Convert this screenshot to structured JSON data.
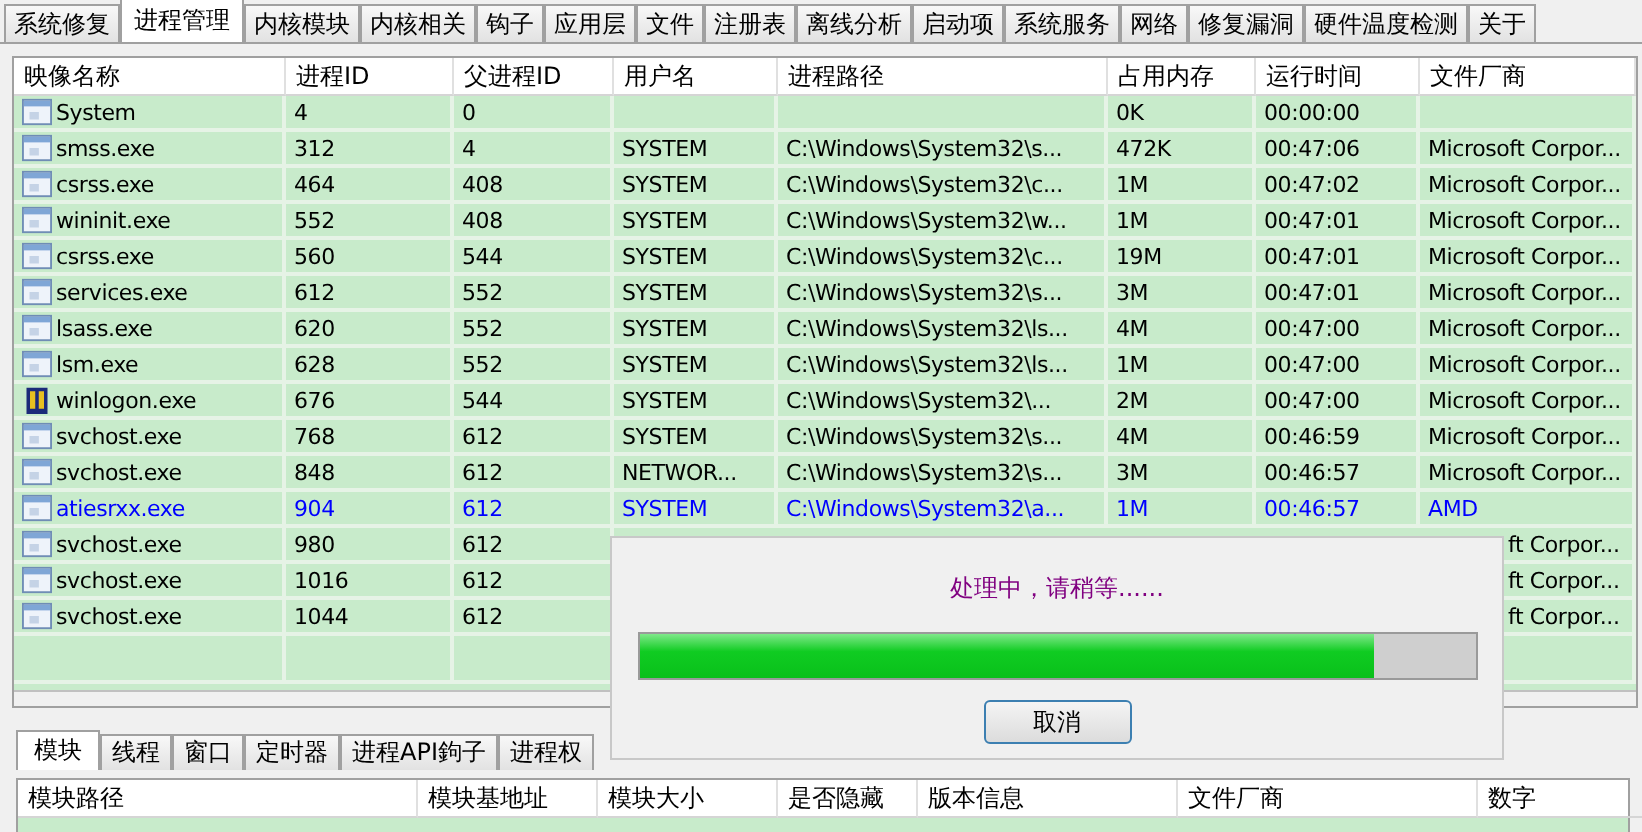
{
  "tabs": [
    {
      "label": "系统修复",
      "selected": false
    },
    {
      "label": "进程管理",
      "selected": true
    },
    {
      "label": "内核模块",
      "selected": false
    },
    {
      "label": "内核相关",
      "selected": false
    },
    {
      "label": "钩子",
      "selected": false
    },
    {
      "label": "应用层",
      "selected": false
    },
    {
      "label": "文件",
      "selected": false
    },
    {
      "label": "注册表",
      "selected": false
    },
    {
      "label": "离线分析",
      "selected": false
    },
    {
      "label": "启动项",
      "selected": false
    },
    {
      "label": "系统服务",
      "selected": false
    },
    {
      "label": "网络",
      "selected": false
    },
    {
      "label": "修复漏洞",
      "selected": false
    },
    {
      "label": "硬件温度检测",
      "selected": false
    },
    {
      "label": "关于",
      "selected": false
    }
  ],
  "process_table": {
    "columns": [
      "映像名称",
      "进程ID",
      "父进程ID",
      "用户名",
      "进程路径",
      "占用内存",
      "运行时间",
      "文件厂商"
    ],
    "rows": [
      {
        "kind": "app",
        "highlighted": false,
        "covered": false,
        "cells": [
          "System",
          "4",
          "0",
          "",
          "",
          "0K",
          "00:00:00",
          ""
        ]
      },
      {
        "kind": "app",
        "highlighted": false,
        "covered": false,
        "cells": [
          "smss.exe",
          "312",
          "4",
          "SYSTEM",
          "C:\\Windows\\System32\\s...",
          "472K",
          "00:47:06",
          "Microsoft Corpor..."
        ]
      },
      {
        "kind": "app",
        "highlighted": false,
        "covered": false,
        "cells": [
          "csrss.exe",
          "464",
          "408",
          "SYSTEM",
          "C:\\Windows\\System32\\c...",
          "1M",
          "00:47:02",
          "Microsoft Corpor..."
        ]
      },
      {
        "kind": "app",
        "highlighted": false,
        "covered": false,
        "cells": [
          "wininit.exe",
          "552",
          "408",
          "SYSTEM",
          "C:\\Windows\\System32\\w...",
          "1M",
          "00:47:01",
          "Microsoft Corpor..."
        ]
      },
      {
        "kind": "app",
        "highlighted": false,
        "covered": false,
        "cells": [
          "csrss.exe",
          "560",
          "544",
          "SYSTEM",
          "C:\\Windows\\System32\\c...",
          "19M",
          "00:47:01",
          "Microsoft Corpor..."
        ]
      },
      {
        "kind": "app",
        "highlighted": false,
        "covered": false,
        "cells": [
          "services.exe",
          "612",
          "552",
          "SYSTEM",
          "C:\\Windows\\System32\\s...",
          "3M",
          "00:47:01",
          "Microsoft Corpor..."
        ]
      },
      {
        "kind": "app",
        "highlighted": false,
        "covered": false,
        "cells": [
          "lsass.exe",
          "620",
          "552",
          "SYSTEM",
          "C:\\Windows\\System32\\ls...",
          "4M",
          "00:47:00",
          "Microsoft Corpor..."
        ]
      },
      {
        "kind": "app",
        "highlighted": false,
        "covered": false,
        "cells": [
          "lsm.exe",
          "628",
          "552",
          "SYSTEM",
          "C:\\Windows\\System32\\ls...",
          "1M",
          "00:47:00",
          "Microsoft Corpor..."
        ]
      },
      {
        "kind": "logon",
        "highlighted": false,
        "covered": false,
        "cells": [
          "winlogon.exe",
          "676",
          "544",
          "SYSTEM",
          "C:\\Windows\\System32\\...",
          "2M",
          "00:47:00",
          "Microsoft Corpor..."
        ]
      },
      {
        "kind": "app",
        "highlighted": false,
        "covered": false,
        "cells": [
          "svchost.exe",
          "768",
          "612",
          "SYSTEM",
          "C:\\Windows\\System32\\s...",
          "4M",
          "00:46:59",
          "Microsoft Corpor..."
        ]
      },
      {
        "kind": "app",
        "highlighted": false,
        "covered": false,
        "cells": [
          "svchost.exe",
          "848",
          "612",
          "NETWOR...",
          "C:\\Windows\\System32\\s...",
          "3M",
          "00:46:57",
          "Microsoft Corpor..."
        ]
      },
      {
        "kind": "app",
        "highlighted": true,
        "covered": false,
        "cells": [
          "atiesrxx.exe",
          "904",
          "612",
          "SYSTEM",
          "C:\\Windows\\System32\\a...",
          "1M",
          "00:46:57",
          "AMD"
        ]
      },
      {
        "kind": "app",
        "highlighted": false,
        "covered": true,
        "cells": [
          "svchost.exe",
          "980",
          "612",
          "",
          "",
          "",
          "",
          "ft Corpor..."
        ]
      },
      {
        "kind": "app",
        "highlighted": false,
        "covered": true,
        "cells": [
          "svchost.exe",
          "1016",
          "612",
          "",
          "",
          "",
          "",
          "ft Corpor..."
        ]
      },
      {
        "kind": "app",
        "highlighted": false,
        "covered": true,
        "cells": [
          "svchost.exe",
          "1044",
          "612",
          "",
          "",
          "",
          "",
          "ft Corpor..."
        ]
      }
    ]
  },
  "bottom_tabs": [
    {
      "label": "模块",
      "selected": true
    },
    {
      "label": "线程",
      "selected": false
    },
    {
      "label": "窗口",
      "selected": false
    },
    {
      "label": "定时器",
      "selected": false
    },
    {
      "label": "进程API鉤子",
      "selected": false
    },
    {
      "label": "进程权",
      "selected": false
    }
  ],
  "module_table": {
    "columns": [
      "模块路径",
      "模块基地址",
      "模块大小",
      "是否隐藏",
      "版本信息",
      "文件厂商",
      "数字"
    ]
  },
  "dialog": {
    "message": "处理中，请稍等......",
    "level": 0.88,
    "button": "取消"
  }
}
